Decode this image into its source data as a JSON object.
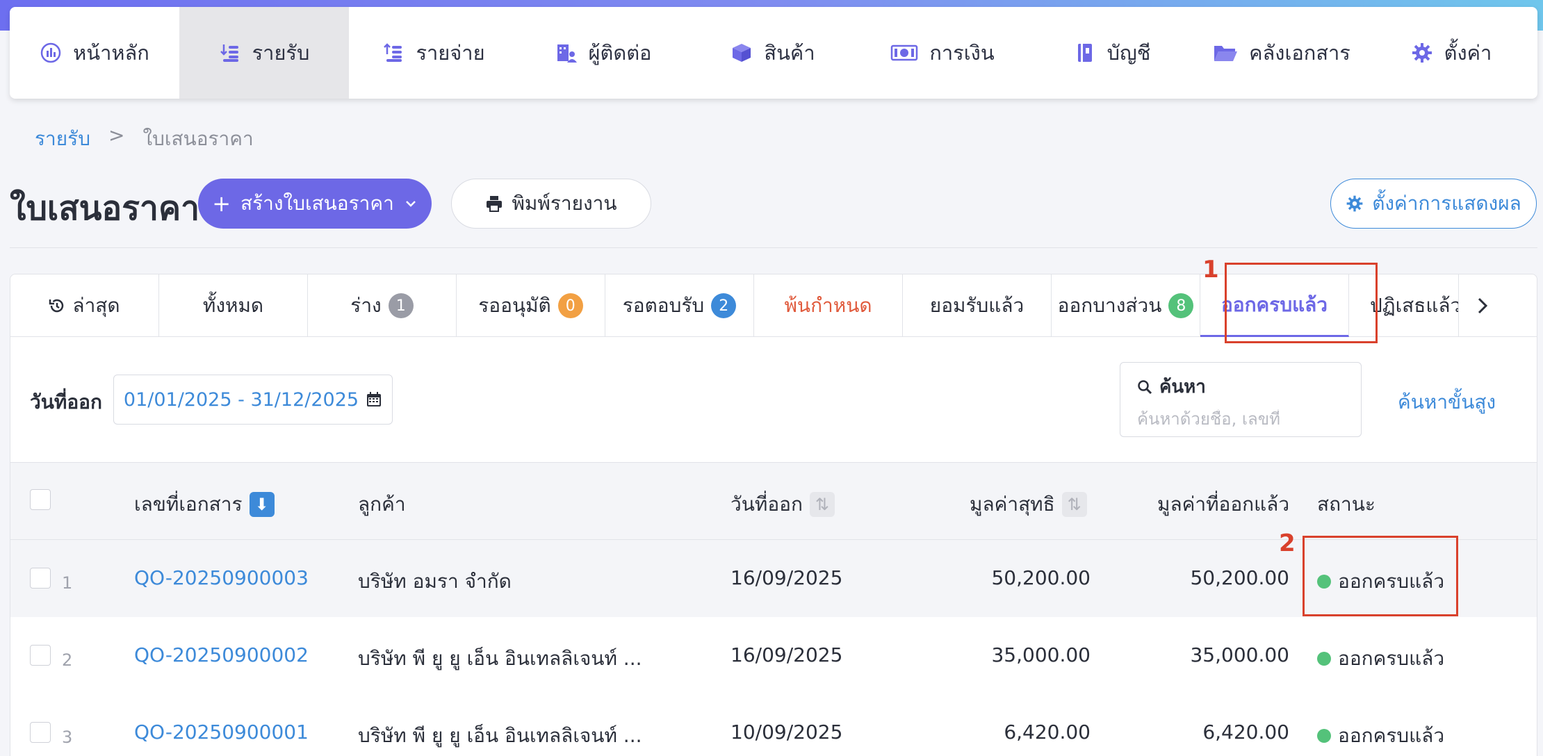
{
  "nav": [
    {
      "label": "หน้าหลัก",
      "icon": "chart-icon"
    },
    {
      "label": "รายรับ",
      "icon": "coins-down-icon",
      "active": true
    },
    {
      "label": "รายจ่าย",
      "icon": "coins-up-icon"
    },
    {
      "label": "ผู้ติดต่อ",
      "icon": "contacts-icon"
    },
    {
      "label": "สินค้า",
      "icon": "box-icon"
    },
    {
      "label": "การเงิน",
      "icon": "money-icon"
    },
    {
      "label": "บัญชี",
      "icon": "ledger-icon"
    },
    {
      "label": "คลังเอกสาร",
      "icon": "folder-icon"
    },
    {
      "label": "ตั้งค่า",
      "icon": "gear-icon"
    }
  ],
  "breadcrumb": {
    "parent": "รายรับ",
    "separator": ">",
    "current": "ใบเสนอราคา"
  },
  "page": {
    "title": "ใบเสนอราคา",
    "create_label": "สร้างใบเสนอราคา",
    "print_label": "พิมพ์รายงาน",
    "display_settings_label": "ตั้งค่าการแสดงผล"
  },
  "tabs": [
    {
      "label": "ล่าสุด",
      "icon": "history-icon"
    },
    {
      "label": "ทั้งหมด"
    },
    {
      "label": "ร่าง",
      "badge": "1",
      "badge_color": "gray"
    },
    {
      "label": "รออนุมัติ",
      "badge": "0",
      "badge_color": "orange"
    },
    {
      "label": "รอตอบรับ",
      "badge": "2",
      "badge_color": "blue"
    },
    {
      "label": "พ้นกำหนด",
      "style": "overdue"
    },
    {
      "label": "ยอมรับแล้ว"
    },
    {
      "label": "ออกบางส่วน",
      "badge": "8",
      "badge_color": "green"
    },
    {
      "label": "ออกครบแล้ว",
      "active": true
    },
    {
      "label": "ปฏิเสธแล้ว"
    }
  ],
  "filters": {
    "date_label": "วันที่ออก",
    "date_range": "01/01/2025 - 31/12/2025",
    "search_title": "ค้นหา",
    "search_placeholder": "ค้นหาด้วยชื่อ, เลขที่",
    "advanced_label": "ค้นหาขั้นสูง"
  },
  "table": {
    "columns": {
      "doc_no": "เลขที่เอกสาร",
      "customer": "ลูกค้า",
      "issue_date": "วันที่ออก",
      "net_value": "มูลค่าสุทธิ",
      "issued_value": "มูลค่าที่ออกแล้ว",
      "status": "สถานะ"
    },
    "rows": [
      {
        "num": "1",
        "doc_no": "QO-20250900003",
        "customer": "บริษัท อมรา จำกัด",
        "issue_date": "16/09/2025",
        "net_value": "50,200.00",
        "issued_value": "50,200.00",
        "status": "ออกครบแล้ว"
      },
      {
        "num": "2",
        "doc_no": "QO-20250900002",
        "customer": "บริษัท พี ยู ยู เอ็น อินเทลลิเจนท์ ...",
        "issue_date": "16/09/2025",
        "net_value": "35,000.00",
        "issued_value": "35,000.00",
        "status": "ออกครบแล้ว"
      },
      {
        "num": "3",
        "doc_no": "QO-20250900001",
        "customer": "บริษัท พี ยู ยู เอ็น อินเทลลิเจนท์ ...",
        "issue_date": "10/09/2025",
        "net_value": "6,420.00",
        "issued_value": "6,420.00",
        "status": "ออกครบแล้ว"
      }
    ]
  },
  "annotations": [
    {
      "label": "1"
    },
    {
      "label": "2"
    }
  ],
  "colors": {
    "accent": "#6d68e6",
    "link": "#3d8ad9",
    "annotation": "#d9412c",
    "status_green": "#54c27a"
  }
}
